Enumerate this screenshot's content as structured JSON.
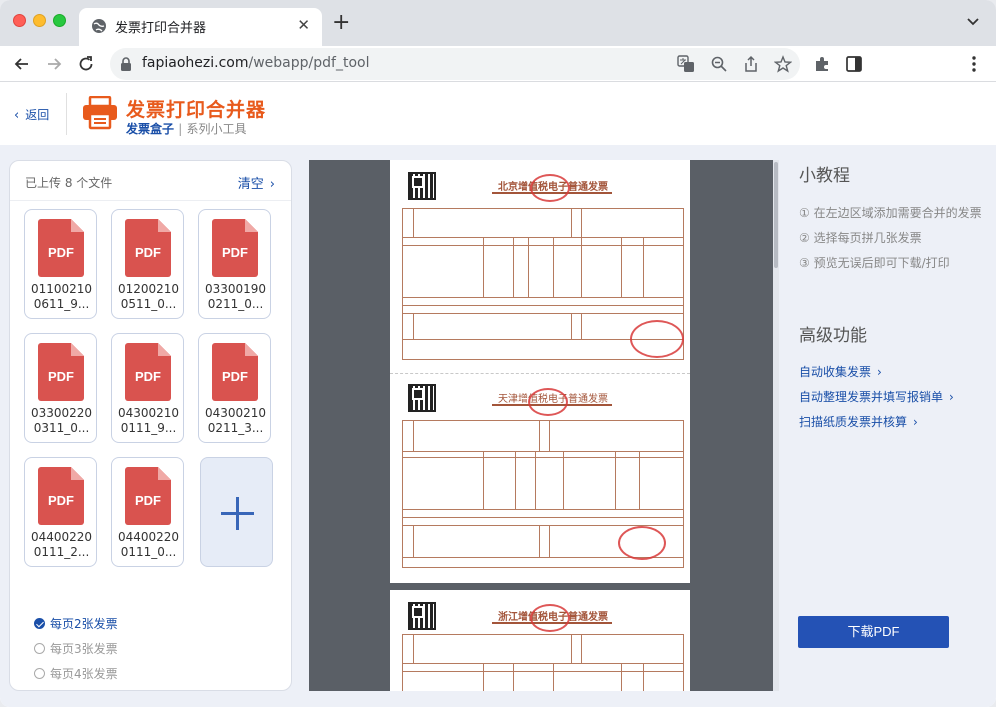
{
  "browser": {
    "tab_title": "发票打印合并器",
    "close_glyph": "✕",
    "newtab_glyph": "+",
    "url_host": "fapiaohezi.com",
    "url_path": "/webapp/pdf_tool",
    "icons": [
      "back-arrow-icon",
      "forward-arrow-icon",
      "reload-icon",
      "lock-icon",
      "translate-icon",
      "zoom-icon",
      "share-icon",
      "bookmark-star-icon",
      "extensions-icon",
      "sidepanel-icon",
      "menu-kebab-icon"
    ]
  },
  "header": {
    "back_label": "返回",
    "back_glyph": "‹",
    "app_title": "发票打印合并器",
    "brand": "发票盒子",
    "brand_sep": "|",
    "brand_sub": "系列小工具"
  },
  "left": {
    "uploaded_label": "已上传 8 个文件",
    "clear_label": "清空",
    "chev": "›",
    "pdf_label": "PDF",
    "files": [
      "011002100611_9...",
      "012002100511_0...",
      "033001900211_0...",
      "033002200311_0...",
      "043002100111_9...",
      "043002100211_3...",
      "044002200111_2...",
      "044002200111_0..."
    ],
    "options": [
      {
        "label": "每页2张发票",
        "checked": true
      },
      {
        "label": "每页3张发票",
        "checked": false
      },
      {
        "label": "每页4张发票",
        "checked": false
      }
    ]
  },
  "preview": {
    "invoices": [
      {
        "title": "北京增值税电子普通发票"
      },
      {
        "title": "天津增值税电子普通发票"
      },
      {
        "title": "浙江增值税电子普通发票"
      }
    ]
  },
  "right": {
    "tutorial_title": "小教程",
    "steps": [
      "① 在左边区域添加需要合并的发票",
      "② 选择每页拼几张发票",
      "③ 预览无误后即可下载/打印"
    ],
    "advanced_title": "高级功能",
    "links": [
      "自动收集发票",
      "自动整理发票并填写报销单",
      "扫描纸质发票并核算"
    ],
    "chev": "›",
    "download_label": "下载PDF"
  },
  "colors": {
    "accent": "#2452b5",
    "link": "#1a4fa8",
    "logo": "#e85a1c",
    "pdf_red": "#d9534f"
  }
}
